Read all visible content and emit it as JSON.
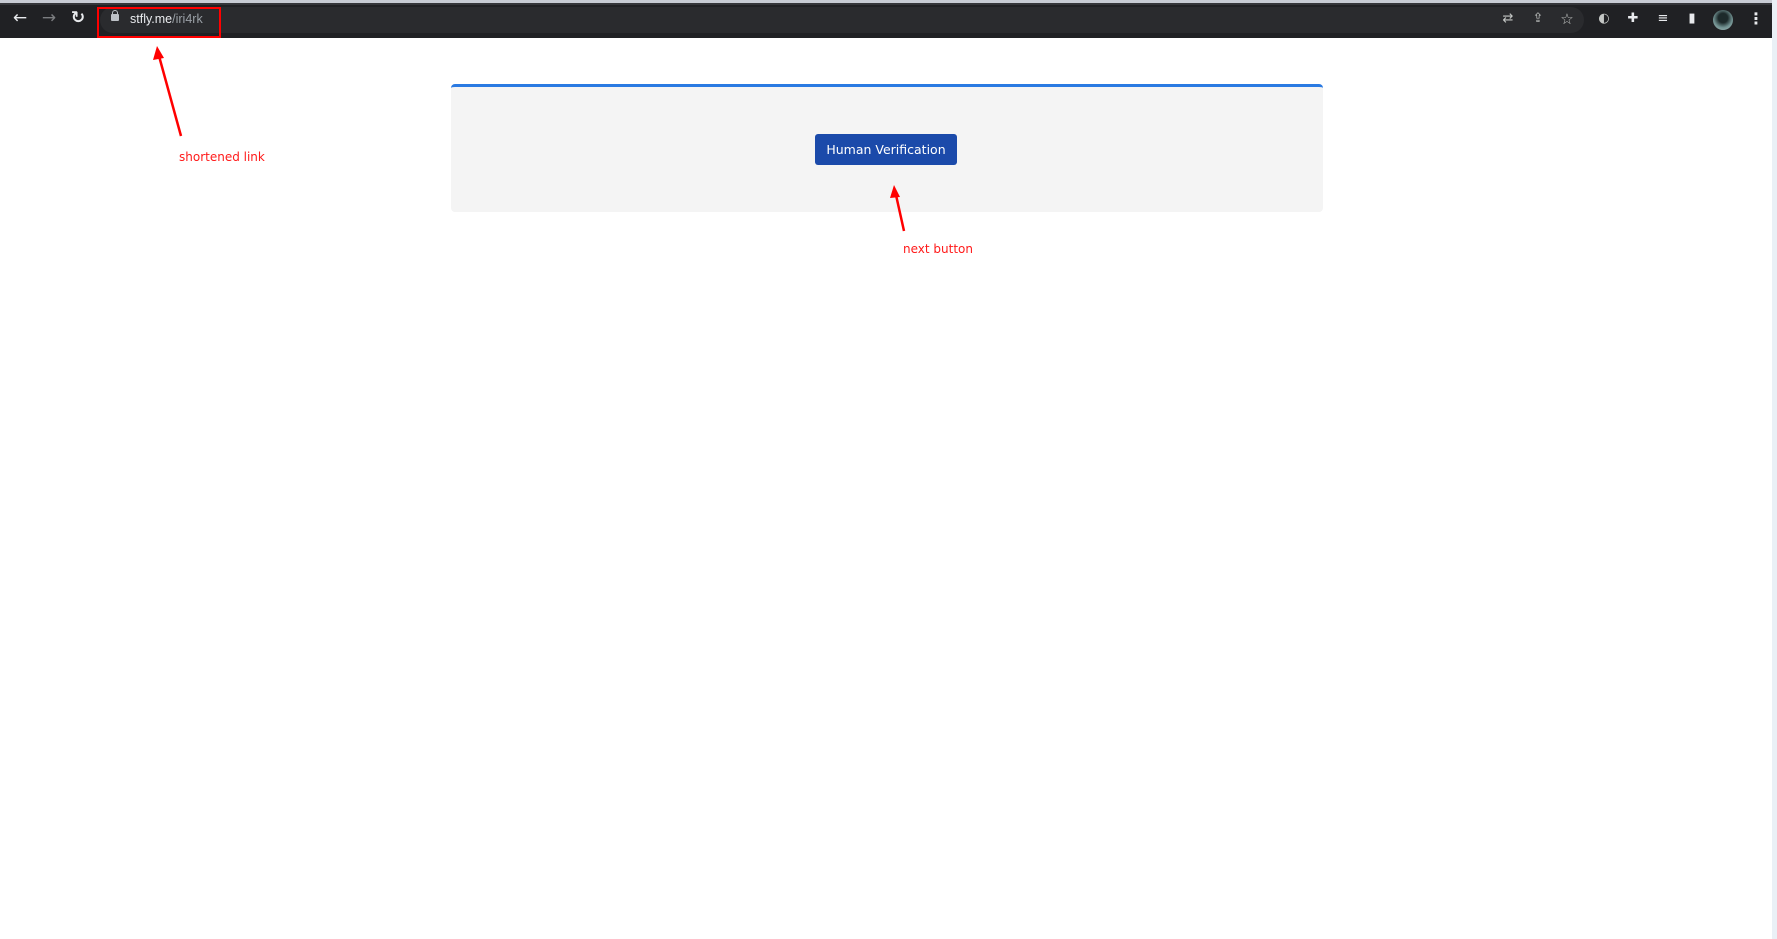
{
  "browser": {
    "url_host": "stfly.me",
    "url_path": "/iri4rk",
    "nav": {
      "back_icon": "←",
      "forward_icon": "→",
      "reload_icon": "↻"
    },
    "toolbar_icons": {
      "translate": "⇄",
      "share": "⇪",
      "bookmark": "☆",
      "extension_s": "◐",
      "extensions": "✚",
      "reading_list": "≡",
      "side_panel": "▮",
      "menu": "⋮"
    }
  },
  "page": {
    "verify_button_label": "Human Verification",
    "accent_color": "#2a7ae2",
    "button_color": "#1b4aaa"
  },
  "annotations": {
    "url_label": "shortened link",
    "button_label": "next button",
    "color": "#ff0000"
  }
}
